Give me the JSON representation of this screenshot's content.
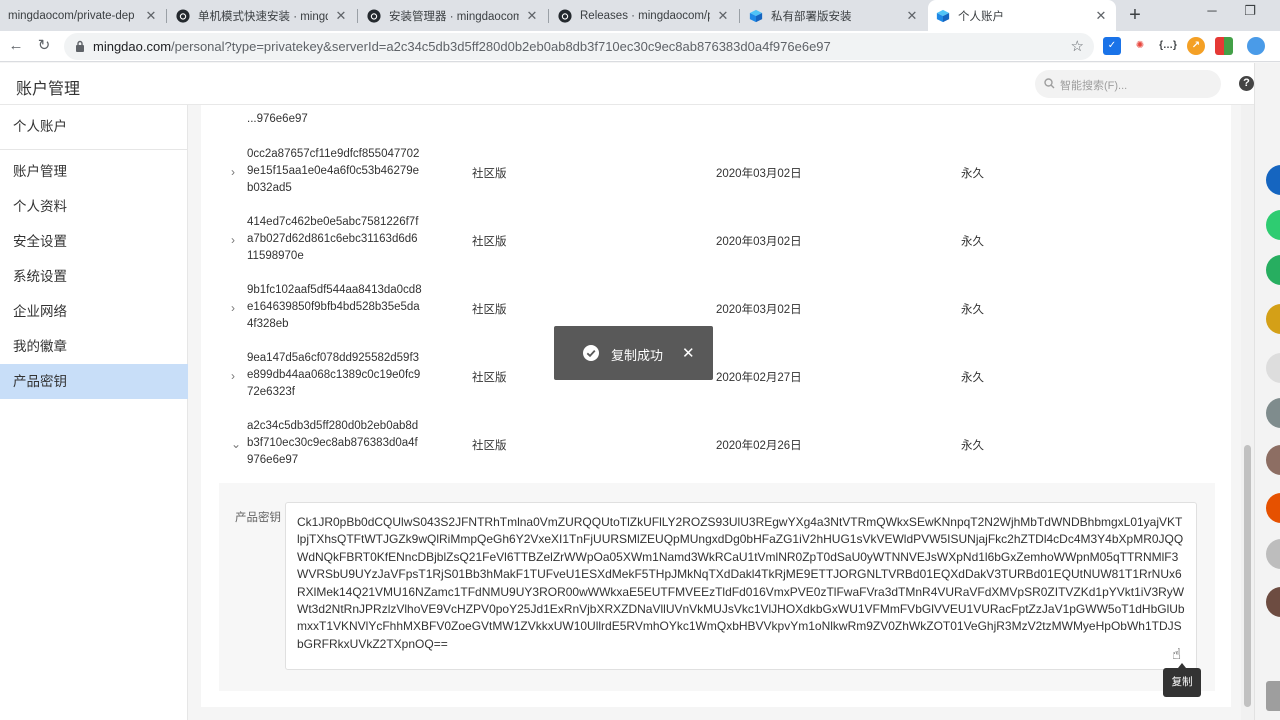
{
  "browser": {
    "tabs": [
      {
        "title": "mingdaocom/private-dep",
        "icon": "github-icon"
      },
      {
        "title": "单机模式快速安装 · mingda",
        "icon": "github-icon"
      },
      {
        "title": "安装管理器 · mingdaocom/",
        "icon": "github-icon"
      },
      {
        "title": "Releases · mingdaocom/p",
        "icon": "github-icon"
      },
      {
        "title": "私有部署版安装",
        "icon": "mingdao-cube-icon"
      },
      {
        "title": "个人账户",
        "icon": "mingdao-cube-icon",
        "active": true
      }
    ],
    "url_host": "mingdao.com",
    "url_path": "/personal?type=privatekey&serverId=a2c34c5db3d5ff280d0b2eb0ab8db3f710ec30c9ec8ab876383d0a4f976e6e97"
  },
  "header": {
    "title": "账户管理",
    "search_placeholder": "智能搜索(F)..."
  },
  "sidebar": {
    "items": [
      {
        "label": "个人账户"
      },
      {
        "label": "账户管理"
      },
      {
        "label": "个人资料"
      },
      {
        "label": "安全设置"
      },
      {
        "label": "系统设置"
      },
      {
        "label": "企业网络"
      },
      {
        "label": "我的徽章"
      },
      {
        "label": "产品密钥",
        "active": true
      }
    ]
  },
  "keys": {
    "rows": [
      {
        "key": "...976e6e97",
        "edition": "社区版",
        "date": "2020年03月02日",
        "expiry": "永久",
        "expanded": false
      },
      {
        "key": "0cc2a87657cf11e9dfcf855047702 9e15f15aa1e0e4a6f0c53b46279e b032ad5",
        "edition": "社区版",
        "date": "2020年03月02日",
        "expiry": "永久",
        "expanded": false
      },
      {
        "key": "414ed7c462be0e5abc7581226f7f a7b027d62d861c6ebc31163d6d6 11598970e",
        "edition": "社区版",
        "date": "2020年03月02日",
        "expiry": "永久",
        "expanded": false
      },
      {
        "key": "9b1fc102aaf5df544aa8413da0cd8 e164639850f9bfb4bd528b35e5da 4f328eb",
        "edition": "社区版",
        "date": "2020年03月02日",
        "expiry": "永久",
        "expanded": false
      },
      {
        "key": "9ea147d5a6cf078dd925582d59f3 e899db44aa068c1389c0c19e0fc9 72e6323f",
        "edition": "社区版",
        "date": "2020年02月27日",
        "expiry": "永久",
        "expanded": false
      },
      {
        "key": "a2c34c5db3d5ff280d0b2eb0ab8d b3f710ec30c9ec8ab876383d0a4f 976e6e97",
        "edition": "社区版",
        "date": "2020年02月26日",
        "expiry": "永久",
        "expanded": true
      }
    ],
    "detail_label": "产品密钥",
    "product_key": "Ck1JR0pBb0dCQUlwS043S2JFNTRhTmlna0VmZURQQUtoTlZkUFlLY2ROZS93UlU3REgwYXg4a3NtVTRmQWkxSEwKNnpqT2N2WjhMbTdWNDBhbmgxL01yajVKTlpjTXhsQTFtWTJGZk9wQlRiMmpQeGh6Y2VxeXI1TnFjUURSMlZEUQpMUngxdDg0bHFaZG1iV2hHUG1sVkVEWldPVW5ISUNjajFkc2hZTDl4cDc4M3Y4bXpMR0JQQWdNQkFBRT0KfENncDBjblZsQ21FeVl6TTBZelZrWWpOa05XWm1Namd3WkRCaU1tVmlNR0ZpT0dSaU0yWTNNVEJsWXpNd1l6bGxZemhoWWpnM05qTTRNMlF3WVRSbU9UYzJaVFpsT1RjS01Bb3hMakF1TUFveU1ESXdMekF5THpJMkNqTXdDakl4TkRjME9ETTJORGNLTVRBd01EQXdDakV3TURBd01EQUtNUW81T1RrNUx6RXlMek14Q21VMU16NZamc1TFdNMU9UY3ROR00wWWkxaE5EUTFMVEEzTldFd016VmxPVE0zTlFwaFVra3dTMnR4VURaVFdXMVpSR0ZITVZKd1pYVkt1iV3RyWWt3d2NtRnJPRzlzVlhoVE9VcHZPV0poY25Jd1ExRnVjbXRXZDNaVllUVnVkMUJsVkc1VlJHOXdkbGxWU1VFMmFVbGlVVEU1VURacFptZzJaV1pGWW5oT1dHbGlUbmxxT1VKNVlYcFhhMXBFV0ZoeGVtMW1ZVkkxUW10UllrdE5RVmhOYkc1WmQxbHBVVkpvYm1oNlkwRm9ZV0ZhWkZOT01VeGhjR3MzV2tzMWMyeHpObWh1TDJSbGRFRkxUVkZ2TXpnOQ==",
    "toast_text": "复制成功",
    "tooltip_text": "复制"
  },
  "colors": {
    "sidebar_active": "#c8def8",
    "toast_bg": "#595959",
    "tooltip_bg": "#333333"
  }
}
